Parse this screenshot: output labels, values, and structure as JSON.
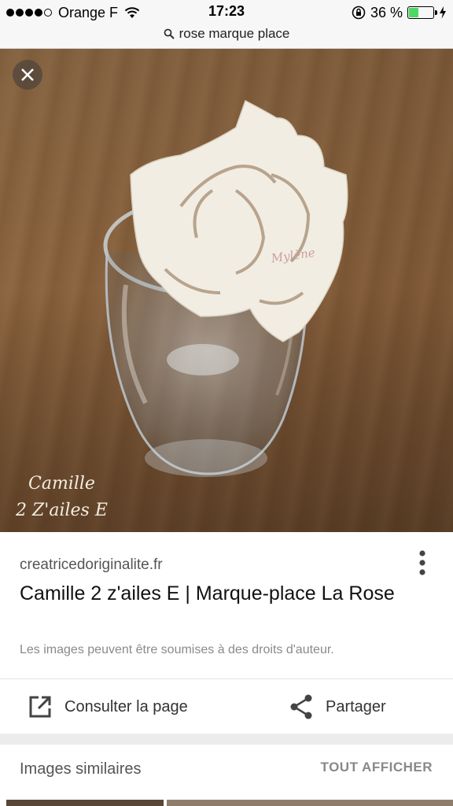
{
  "status_bar": {
    "carrier": "Orange F",
    "time": "17:23",
    "battery": "36 %",
    "battery_level": 0.36,
    "signal_bars": 4
  },
  "url_bar": {
    "query": "rose marque place"
  },
  "image": {
    "card_name": "Mylène",
    "watermark_line1": "Camille",
    "watermark_line2": "2 Z'ailes E"
  },
  "result": {
    "domain": "creatricedoriginalite.fr",
    "title": "Camille 2 z'ailes E | Marque-place La Rose",
    "rights_notice": "Les images peuvent être soumises à des droits d'auteur."
  },
  "actions": {
    "open_page": "Consulter la page",
    "share": "Partager"
  },
  "similar": {
    "label": "Images similaires",
    "show_all": "TOUT AFFICHER"
  },
  "icons": {
    "close": "close-icon",
    "search": "search-icon",
    "more": "more-vert-icon",
    "open": "open-in-new-icon",
    "share": "share-icon"
  }
}
